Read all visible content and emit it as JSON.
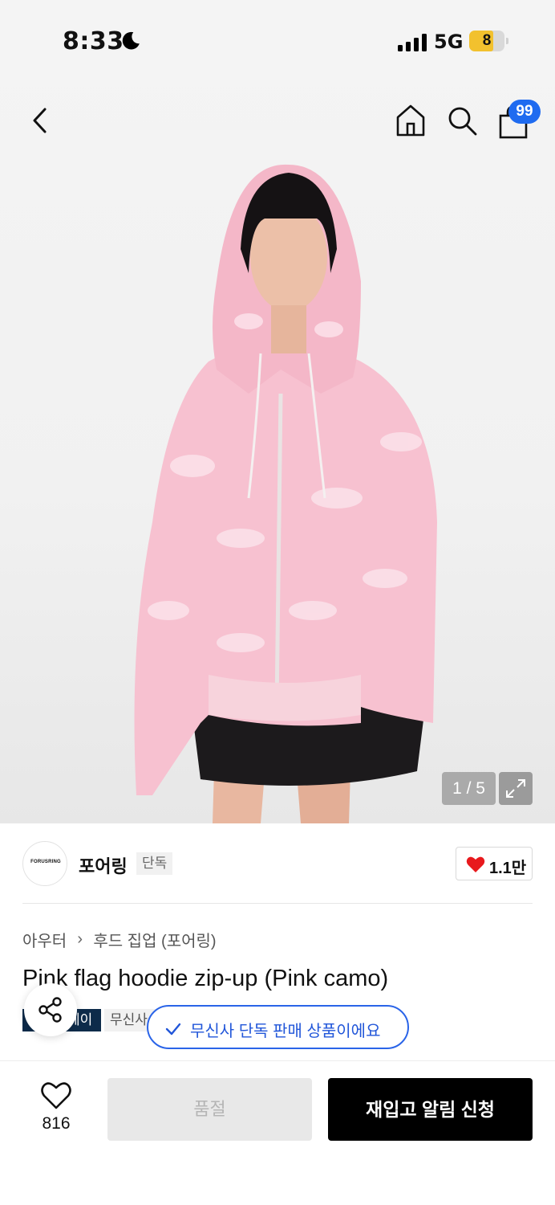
{
  "status_bar": {
    "time": "8:33",
    "network": "5G",
    "battery_level": "8"
  },
  "header": {
    "cart_count": "99",
    "icons": [
      "back-icon",
      "home-icon",
      "search-icon",
      "shopping-bag-icon"
    ]
  },
  "gallery": {
    "counter": "1 / 5"
  },
  "brand": {
    "logo_text": "FORUSRING",
    "name": "포어링",
    "exclusive_tag": "단독",
    "likes": "1.1만"
  },
  "breadcrumb": {
    "category": "아우터",
    "subcategory": "후드 집업 (포어링)"
  },
  "product": {
    "title": "Pink flag hoodie zip-up (Pink camo)",
    "chip_dark": "페이",
    "chip_light": "무신사"
  },
  "toast": {
    "message": "무신사 단독 판매 상품이에요"
  },
  "bottom_bar": {
    "wishlist_count": "816",
    "sold_out_label": "품절",
    "restock_label": "재입고 알림 신청"
  },
  "colors": {
    "accent_blue": "#1f6bf0",
    "toast_blue": "#2156d9",
    "heart_red": "#e8191d",
    "primary_button": "#000000"
  }
}
